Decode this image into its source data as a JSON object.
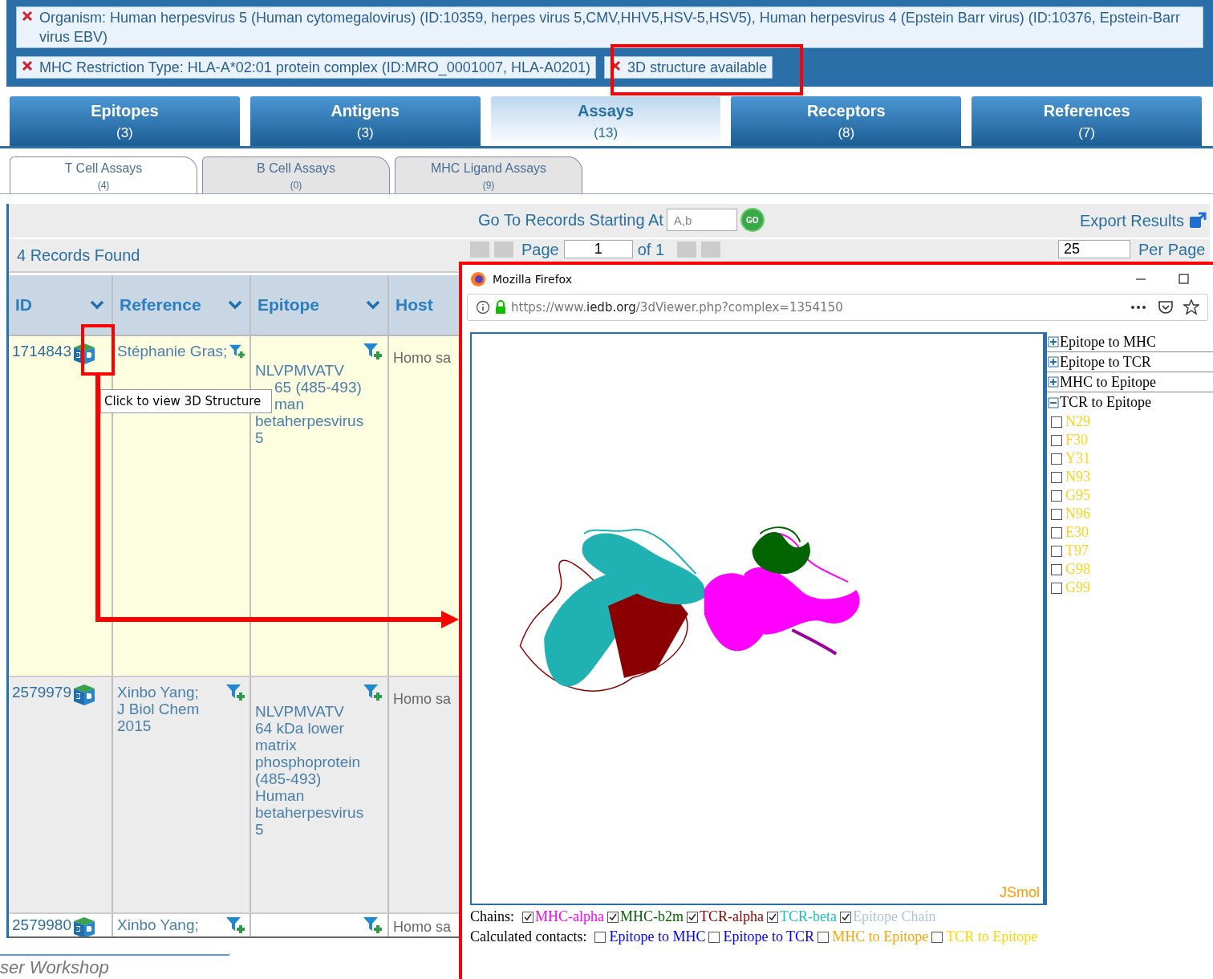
{
  "filters": [
    {
      "label": "Organism: Human herpesvirus 5 (Human cytomegalovirus) (ID:10359, herpes virus 5,CMV,HHV5,HSV-5,HSV5), Human herpesvirus 4 (Epstein Barr virus) (ID:10376, Epstein-Barr virus EBV)"
    },
    {
      "label": "MHC Restriction Type: HLA-A*02:01 protein complex (ID:MRO_0001007, HLA-A0201)"
    },
    {
      "label": "3D structure available"
    }
  ],
  "tabs": [
    {
      "label": "Epitopes",
      "count": "(3)",
      "selected": false
    },
    {
      "label": "Antigens",
      "count": "(3)",
      "selected": false
    },
    {
      "label": "Assays",
      "count": "(13)",
      "selected": true
    },
    {
      "label": "Receptors",
      "count": "(8)",
      "selected": false
    },
    {
      "label": "References",
      "count": "(7)",
      "selected": false
    }
  ],
  "subtabs": [
    {
      "label": "T Cell Assays",
      "count": "(4)",
      "selected": true
    },
    {
      "label": "B Cell Assays",
      "count": "(0)",
      "selected": false
    },
    {
      "label": "MHC Ligand Assays",
      "count": "(9)",
      "selected": false
    }
  ],
  "toolbar": {
    "goto_label": "Go To Records Starting At",
    "goto_placeholder": "A,b",
    "go_button": "GO",
    "export": "Export Results"
  },
  "records": {
    "found": "4 Records Found",
    "page_label": "Page",
    "page": "1",
    "of": "of 1",
    "per_page": "25",
    "per_page_label": "Per Page"
  },
  "table": {
    "columns": [
      {
        "label": "ID",
        "sortable": true
      },
      {
        "label": "Reference",
        "sortable": true
      },
      {
        "label": "Epitope",
        "sortable": true
      },
      {
        "label": "Host",
        "sortable": false
      }
    ],
    "rows": [
      {
        "id": "1714843",
        "has_3d": true,
        "highlighted": true,
        "reference": [
          "Stéphanie Gras;"
        ],
        "epitope": [
          "NLVPMVATV",
          "65 (485-493)",
          "man",
          "betaherpesvirus",
          "5"
        ],
        "host": "Homo sa"
      },
      {
        "id": "2579979",
        "has_3d": true,
        "highlighted": false,
        "reference": [
          "Xinbo Yang;",
          "J Biol Chem",
          "2015"
        ],
        "epitope": [
          "NLVPMVATV",
          "64 kDa lower",
          "matrix",
          "phosphoprotein",
          "(485-493)",
          "Human",
          "betaherpesvirus",
          "5"
        ],
        "host": "Homo sa"
      },
      {
        "id": "2579980",
        "has_3d": true,
        "highlighted": false,
        "reference": [
          "Xinbo Yang;"
        ],
        "epitope": [],
        "host": "Homo sa"
      }
    ]
  },
  "tooltip": "Click to view 3D Structure",
  "footer": "ser Workshop",
  "browser": {
    "title": "Mozilla Firefox",
    "url_prefix": "https://www.",
    "url_domain": "iedb.org",
    "url_path": "/3dViewer.php?complex=1354150",
    "viewer_label": "JSmol",
    "panels": [
      {
        "label": "Epitope to MHC",
        "expanded": false
      },
      {
        "label": "Epitope to TCR",
        "expanded": false
      },
      {
        "label": "MHC to Epitope",
        "expanded": false
      },
      {
        "label": "TCR to Epitope",
        "expanded": true,
        "residues": [
          {
            "label": "N29",
            "checked": false
          },
          {
            "label": "F30",
            "checked": false
          },
          {
            "label": "Y31",
            "checked": false
          },
          {
            "label": "N93",
            "checked": false
          },
          {
            "label": "G95",
            "checked": false
          },
          {
            "label": "N96",
            "checked": false
          },
          {
            "label": "E30",
            "checked": false
          },
          {
            "label": "T97",
            "checked": false
          },
          {
            "label": "G98",
            "checked": false
          },
          {
            "label": "G99",
            "checked": false
          }
        ]
      }
    ],
    "chains_label": "Chains:",
    "chains": [
      {
        "label": "MHC-alpha",
        "checked": true,
        "color": "#ff00ff"
      },
      {
        "label": "MHC-b2m",
        "checked": true,
        "color": "#006400"
      },
      {
        "label": "TCR-alpha",
        "checked": true,
        "color": "#8b0000"
      },
      {
        "label": "TCR-beta",
        "checked": true,
        "color": "#20c0c0"
      },
      {
        "label": "Epitope Chain",
        "checked": true,
        "color": "#b0c4de"
      }
    ],
    "contacts_label": "Calculated contacts:",
    "contacts": [
      {
        "label": "Epitope to MHC",
        "checked": false,
        "color": "#0000ff"
      },
      {
        "label": "Epitope to TCR",
        "checked": false,
        "color": "#0000ff"
      },
      {
        "label": "MHC to Epitope",
        "checked": false,
        "color": "#ffa500"
      },
      {
        "label": "TCR to Epitope",
        "checked": false,
        "color": "#ffd700"
      }
    ]
  }
}
